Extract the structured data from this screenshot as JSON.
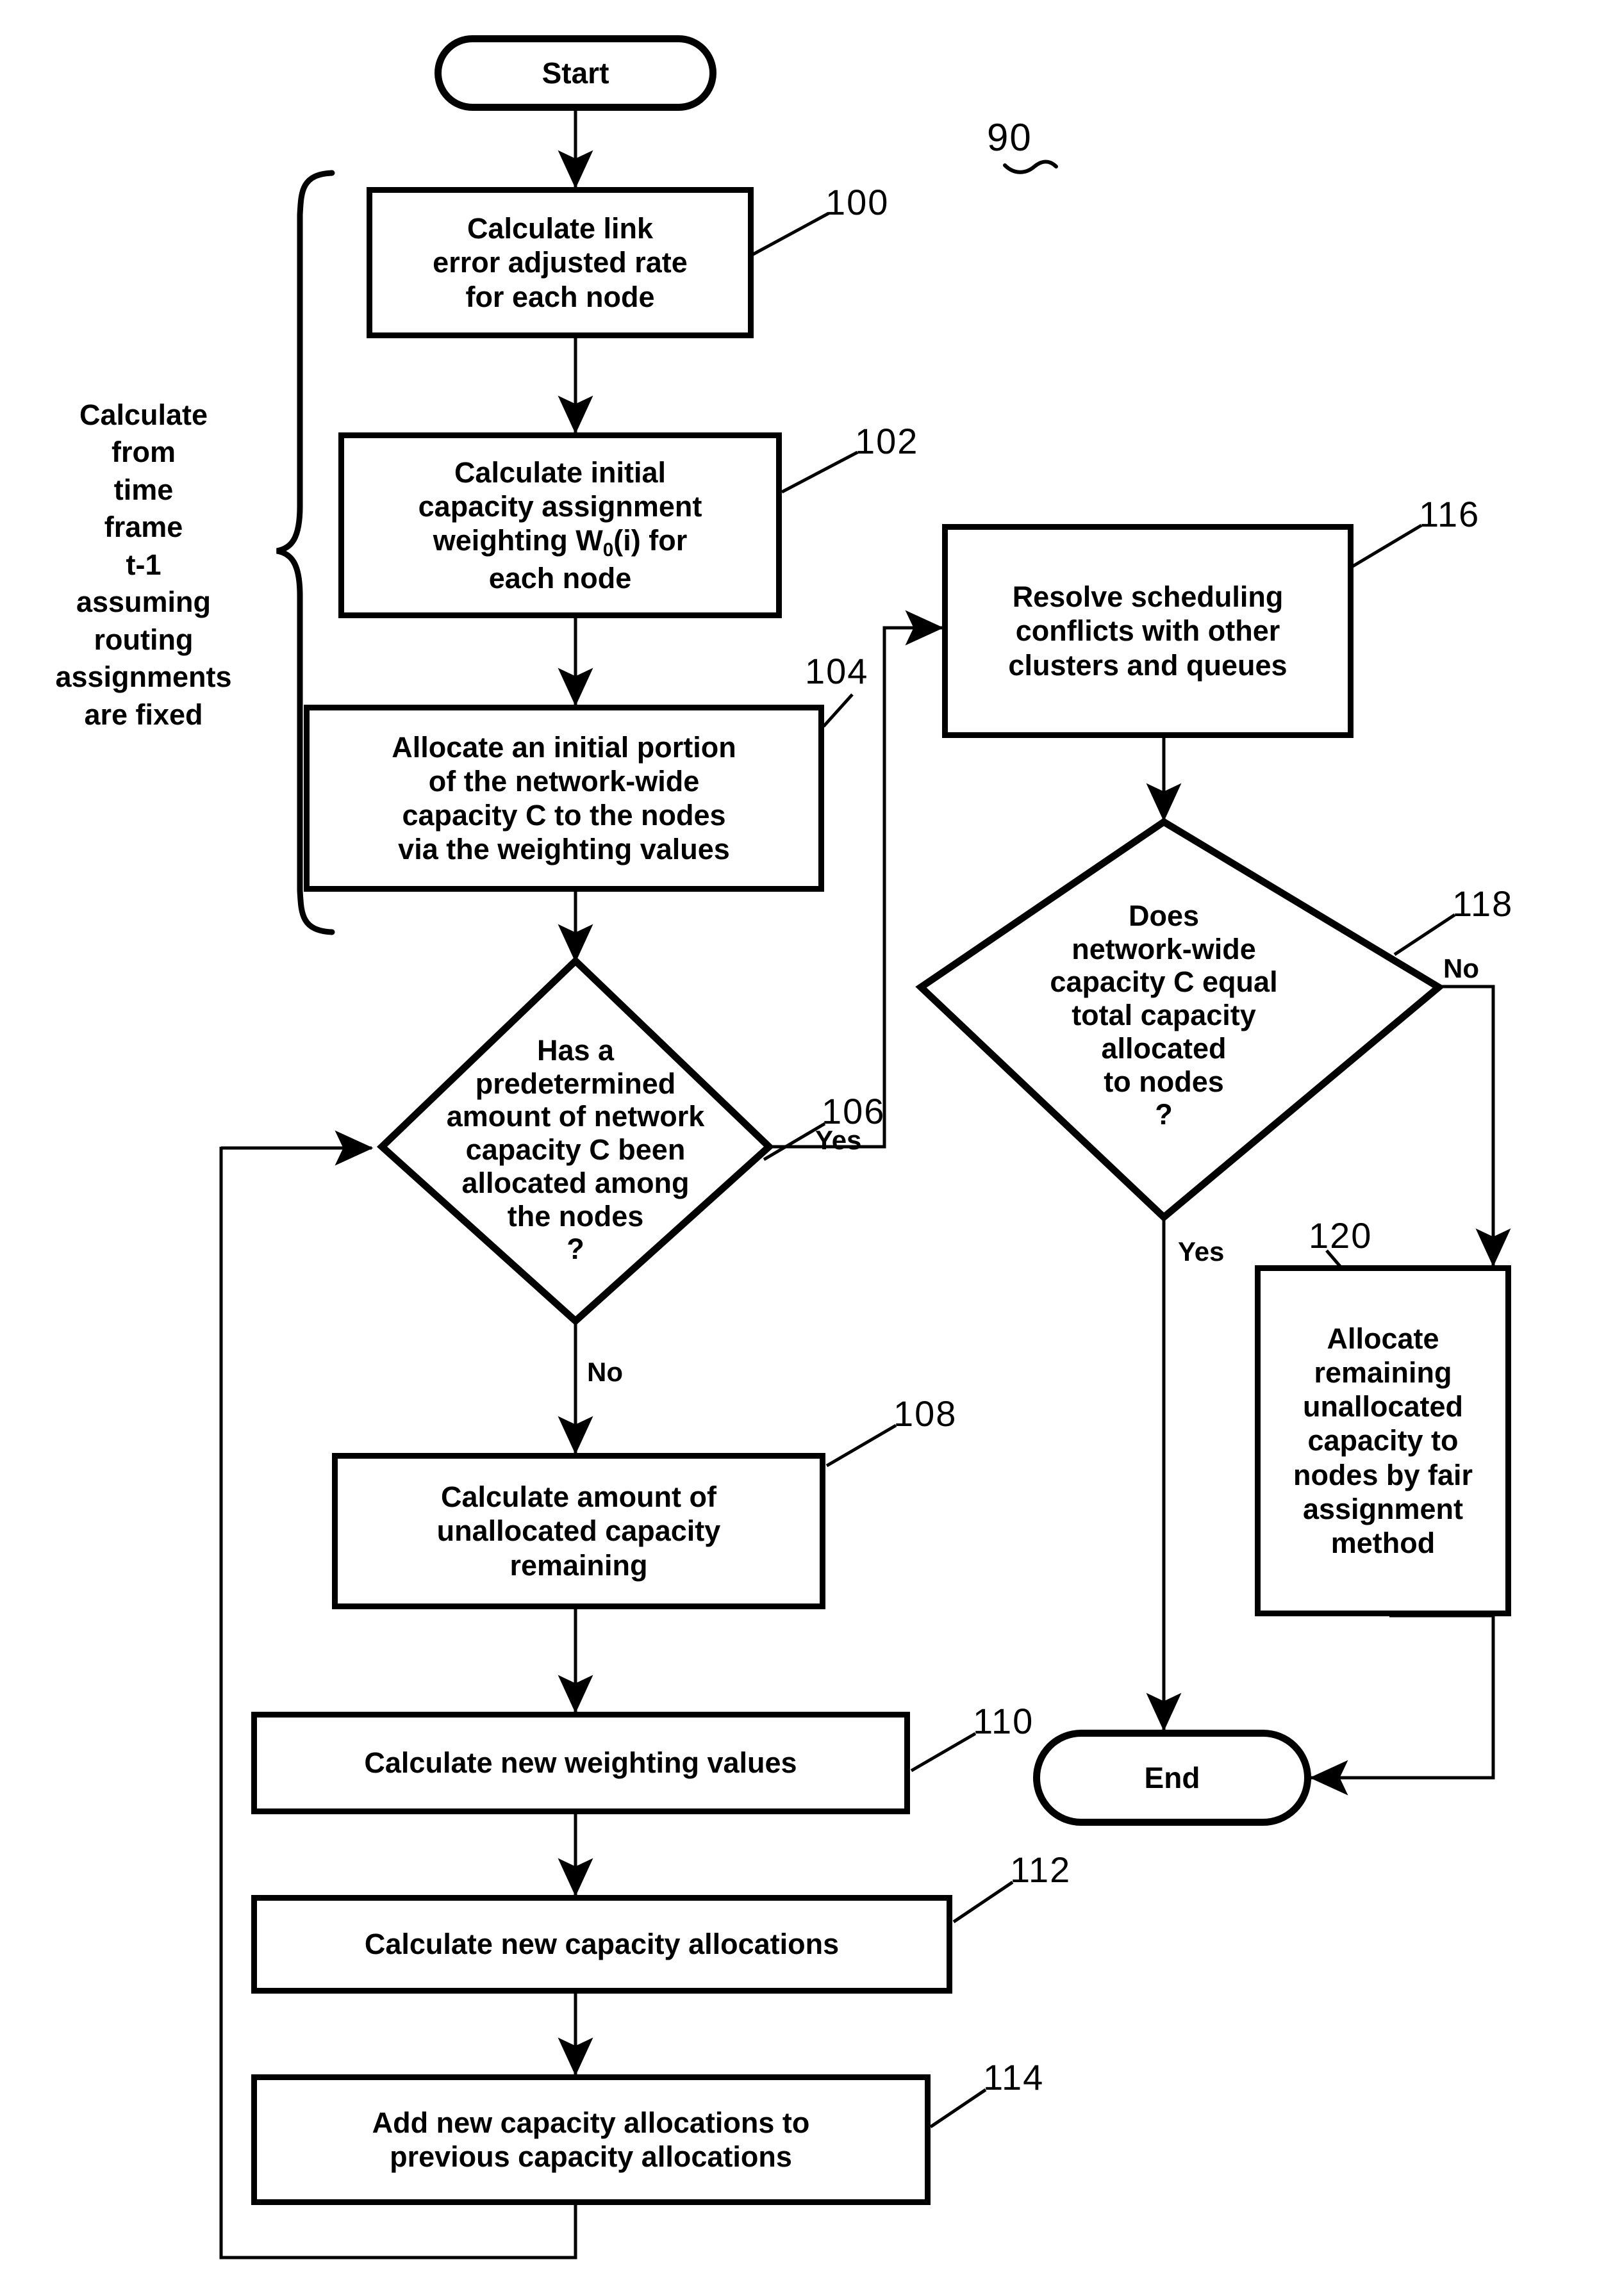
{
  "figure": {
    "reference_numeral": "90"
  },
  "side_note": {
    "text": "Calculate\nfrom\ntime\nframe\nt-1\nassuming\nrouting\nassignments\nare fixed"
  },
  "nodes": {
    "start": {
      "label": "Start",
      "ref": ""
    },
    "n100": {
      "label": "Calculate link\nerror adjusted rate\nfor each node",
      "ref": "100"
    },
    "n102": {
      "label_pre": "Calculate initial\ncapacity assignment\nweighting W",
      "label_sub": "0",
      "label_post": "(i) for\neach node",
      "ref": "102"
    },
    "n104": {
      "label": "Allocate an initial portion\nof the network-wide\ncapacity C to the nodes\nvia the weighting values",
      "ref": "104"
    },
    "n106": {
      "label": "Has a\npredetermined\namount of network\ncapacity C been\nallocated among\nthe nodes\n?",
      "ref": "106"
    },
    "n108": {
      "label": "Calculate amount of\nunallocated capacity\nremaining",
      "ref": "108"
    },
    "n110": {
      "label": "Calculate new weighting values",
      "ref": "110"
    },
    "n112": {
      "label": "Calculate new capacity allocations",
      "ref": "112"
    },
    "n114": {
      "label": "Add new capacity allocations to\nprevious capacity allocations",
      "ref": "114"
    },
    "n116": {
      "label": "Resolve scheduling\nconflicts with other\nclusters  and queues",
      "ref": "116"
    },
    "n118": {
      "label": "Does\nnetwork-wide\ncapacity C equal\ntotal capacity\nallocated\nto nodes\n?",
      "ref": "118"
    },
    "n120": {
      "label": "Allocate\nremaining\nunallocated\ncapacity to\nnodes by fair\nassignment\nmethod",
      "ref": "120"
    },
    "end": {
      "label": "End",
      "ref": ""
    }
  },
  "edge_labels": {
    "d106_yes": "Yes",
    "d106_no": "No",
    "d118_yes": "Yes",
    "d118_no": "No"
  },
  "colors": {
    "line": "#000000",
    "background": "#ffffff"
  }
}
